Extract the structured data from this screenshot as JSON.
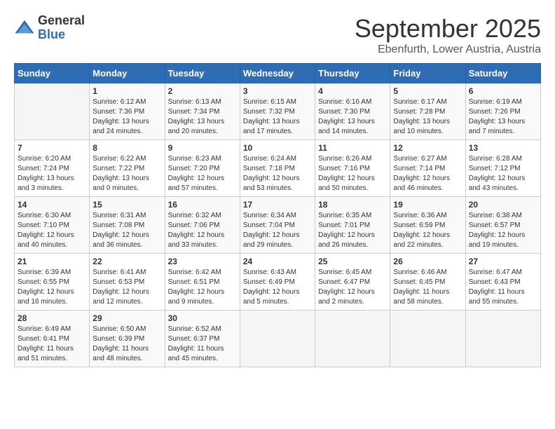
{
  "logo": {
    "general": "General",
    "blue": "Blue"
  },
  "title": "September 2025",
  "location": "Ebenfurth, Lower Austria, Austria",
  "days_of_week": [
    "Sunday",
    "Monday",
    "Tuesday",
    "Wednesday",
    "Thursday",
    "Friday",
    "Saturday"
  ],
  "weeks": [
    [
      {
        "day": "",
        "info": ""
      },
      {
        "day": "1",
        "info": "Sunrise: 6:12 AM\nSunset: 7:36 PM\nDaylight: 13 hours\nand 24 minutes."
      },
      {
        "day": "2",
        "info": "Sunrise: 6:13 AM\nSunset: 7:34 PM\nDaylight: 13 hours\nand 20 minutes."
      },
      {
        "day": "3",
        "info": "Sunrise: 6:15 AM\nSunset: 7:32 PM\nDaylight: 13 hours\nand 17 minutes."
      },
      {
        "day": "4",
        "info": "Sunrise: 6:16 AM\nSunset: 7:30 PM\nDaylight: 13 hours\nand 14 minutes."
      },
      {
        "day": "5",
        "info": "Sunrise: 6:17 AM\nSunset: 7:28 PM\nDaylight: 13 hours\nand 10 minutes."
      },
      {
        "day": "6",
        "info": "Sunrise: 6:19 AM\nSunset: 7:26 PM\nDaylight: 13 hours\nand 7 minutes."
      }
    ],
    [
      {
        "day": "7",
        "info": "Sunrise: 6:20 AM\nSunset: 7:24 PM\nDaylight: 13 hours\nand 3 minutes."
      },
      {
        "day": "8",
        "info": "Sunrise: 6:22 AM\nSunset: 7:22 PM\nDaylight: 13 hours\nand 0 minutes."
      },
      {
        "day": "9",
        "info": "Sunrise: 6:23 AM\nSunset: 7:20 PM\nDaylight: 12 hours\nand 57 minutes."
      },
      {
        "day": "10",
        "info": "Sunrise: 6:24 AM\nSunset: 7:18 PM\nDaylight: 12 hours\nand 53 minutes."
      },
      {
        "day": "11",
        "info": "Sunrise: 6:26 AM\nSunset: 7:16 PM\nDaylight: 12 hours\nand 50 minutes."
      },
      {
        "day": "12",
        "info": "Sunrise: 6:27 AM\nSunset: 7:14 PM\nDaylight: 12 hours\nand 46 minutes."
      },
      {
        "day": "13",
        "info": "Sunrise: 6:28 AM\nSunset: 7:12 PM\nDaylight: 12 hours\nand 43 minutes."
      }
    ],
    [
      {
        "day": "14",
        "info": "Sunrise: 6:30 AM\nSunset: 7:10 PM\nDaylight: 12 hours\nand 40 minutes."
      },
      {
        "day": "15",
        "info": "Sunrise: 6:31 AM\nSunset: 7:08 PM\nDaylight: 12 hours\nand 36 minutes."
      },
      {
        "day": "16",
        "info": "Sunrise: 6:32 AM\nSunset: 7:06 PM\nDaylight: 12 hours\nand 33 minutes."
      },
      {
        "day": "17",
        "info": "Sunrise: 6:34 AM\nSunset: 7:04 PM\nDaylight: 12 hours\nand 29 minutes."
      },
      {
        "day": "18",
        "info": "Sunrise: 6:35 AM\nSunset: 7:01 PM\nDaylight: 12 hours\nand 26 minutes."
      },
      {
        "day": "19",
        "info": "Sunrise: 6:36 AM\nSunset: 6:59 PM\nDaylight: 12 hours\nand 22 minutes."
      },
      {
        "day": "20",
        "info": "Sunrise: 6:38 AM\nSunset: 6:57 PM\nDaylight: 12 hours\nand 19 minutes."
      }
    ],
    [
      {
        "day": "21",
        "info": "Sunrise: 6:39 AM\nSunset: 6:55 PM\nDaylight: 12 hours\nand 16 minutes."
      },
      {
        "day": "22",
        "info": "Sunrise: 6:41 AM\nSunset: 6:53 PM\nDaylight: 12 hours\nand 12 minutes."
      },
      {
        "day": "23",
        "info": "Sunrise: 6:42 AM\nSunset: 6:51 PM\nDaylight: 12 hours\nand 9 minutes."
      },
      {
        "day": "24",
        "info": "Sunrise: 6:43 AM\nSunset: 6:49 PM\nDaylight: 12 hours\nand 5 minutes."
      },
      {
        "day": "25",
        "info": "Sunrise: 6:45 AM\nSunset: 6:47 PM\nDaylight: 12 hours\nand 2 minutes."
      },
      {
        "day": "26",
        "info": "Sunrise: 6:46 AM\nSunset: 6:45 PM\nDaylight: 11 hours\nand 58 minutes."
      },
      {
        "day": "27",
        "info": "Sunrise: 6:47 AM\nSunset: 6:43 PM\nDaylight: 11 hours\nand 55 minutes."
      }
    ],
    [
      {
        "day": "28",
        "info": "Sunrise: 6:49 AM\nSunset: 6:41 PM\nDaylight: 11 hours\nand 51 minutes."
      },
      {
        "day": "29",
        "info": "Sunrise: 6:50 AM\nSunset: 6:39 PM\nDaylight: 11 hours\nand 48 minutes."
      },
      {
        "day": "30",
        "info": "Sunrise: 6:52 AM\nSunset: 6:37 PM\nDaylight: 11 hours\nand 45 minutes."
      },
      {
        "day": "",
        "info": ""
      },
      {
        "day": "",
        "info": ""
      },
      {
        "day": "",
        "info": ""
      },
      {
        "day": "",
        "info": ""
      }
    ]
  ]
}
